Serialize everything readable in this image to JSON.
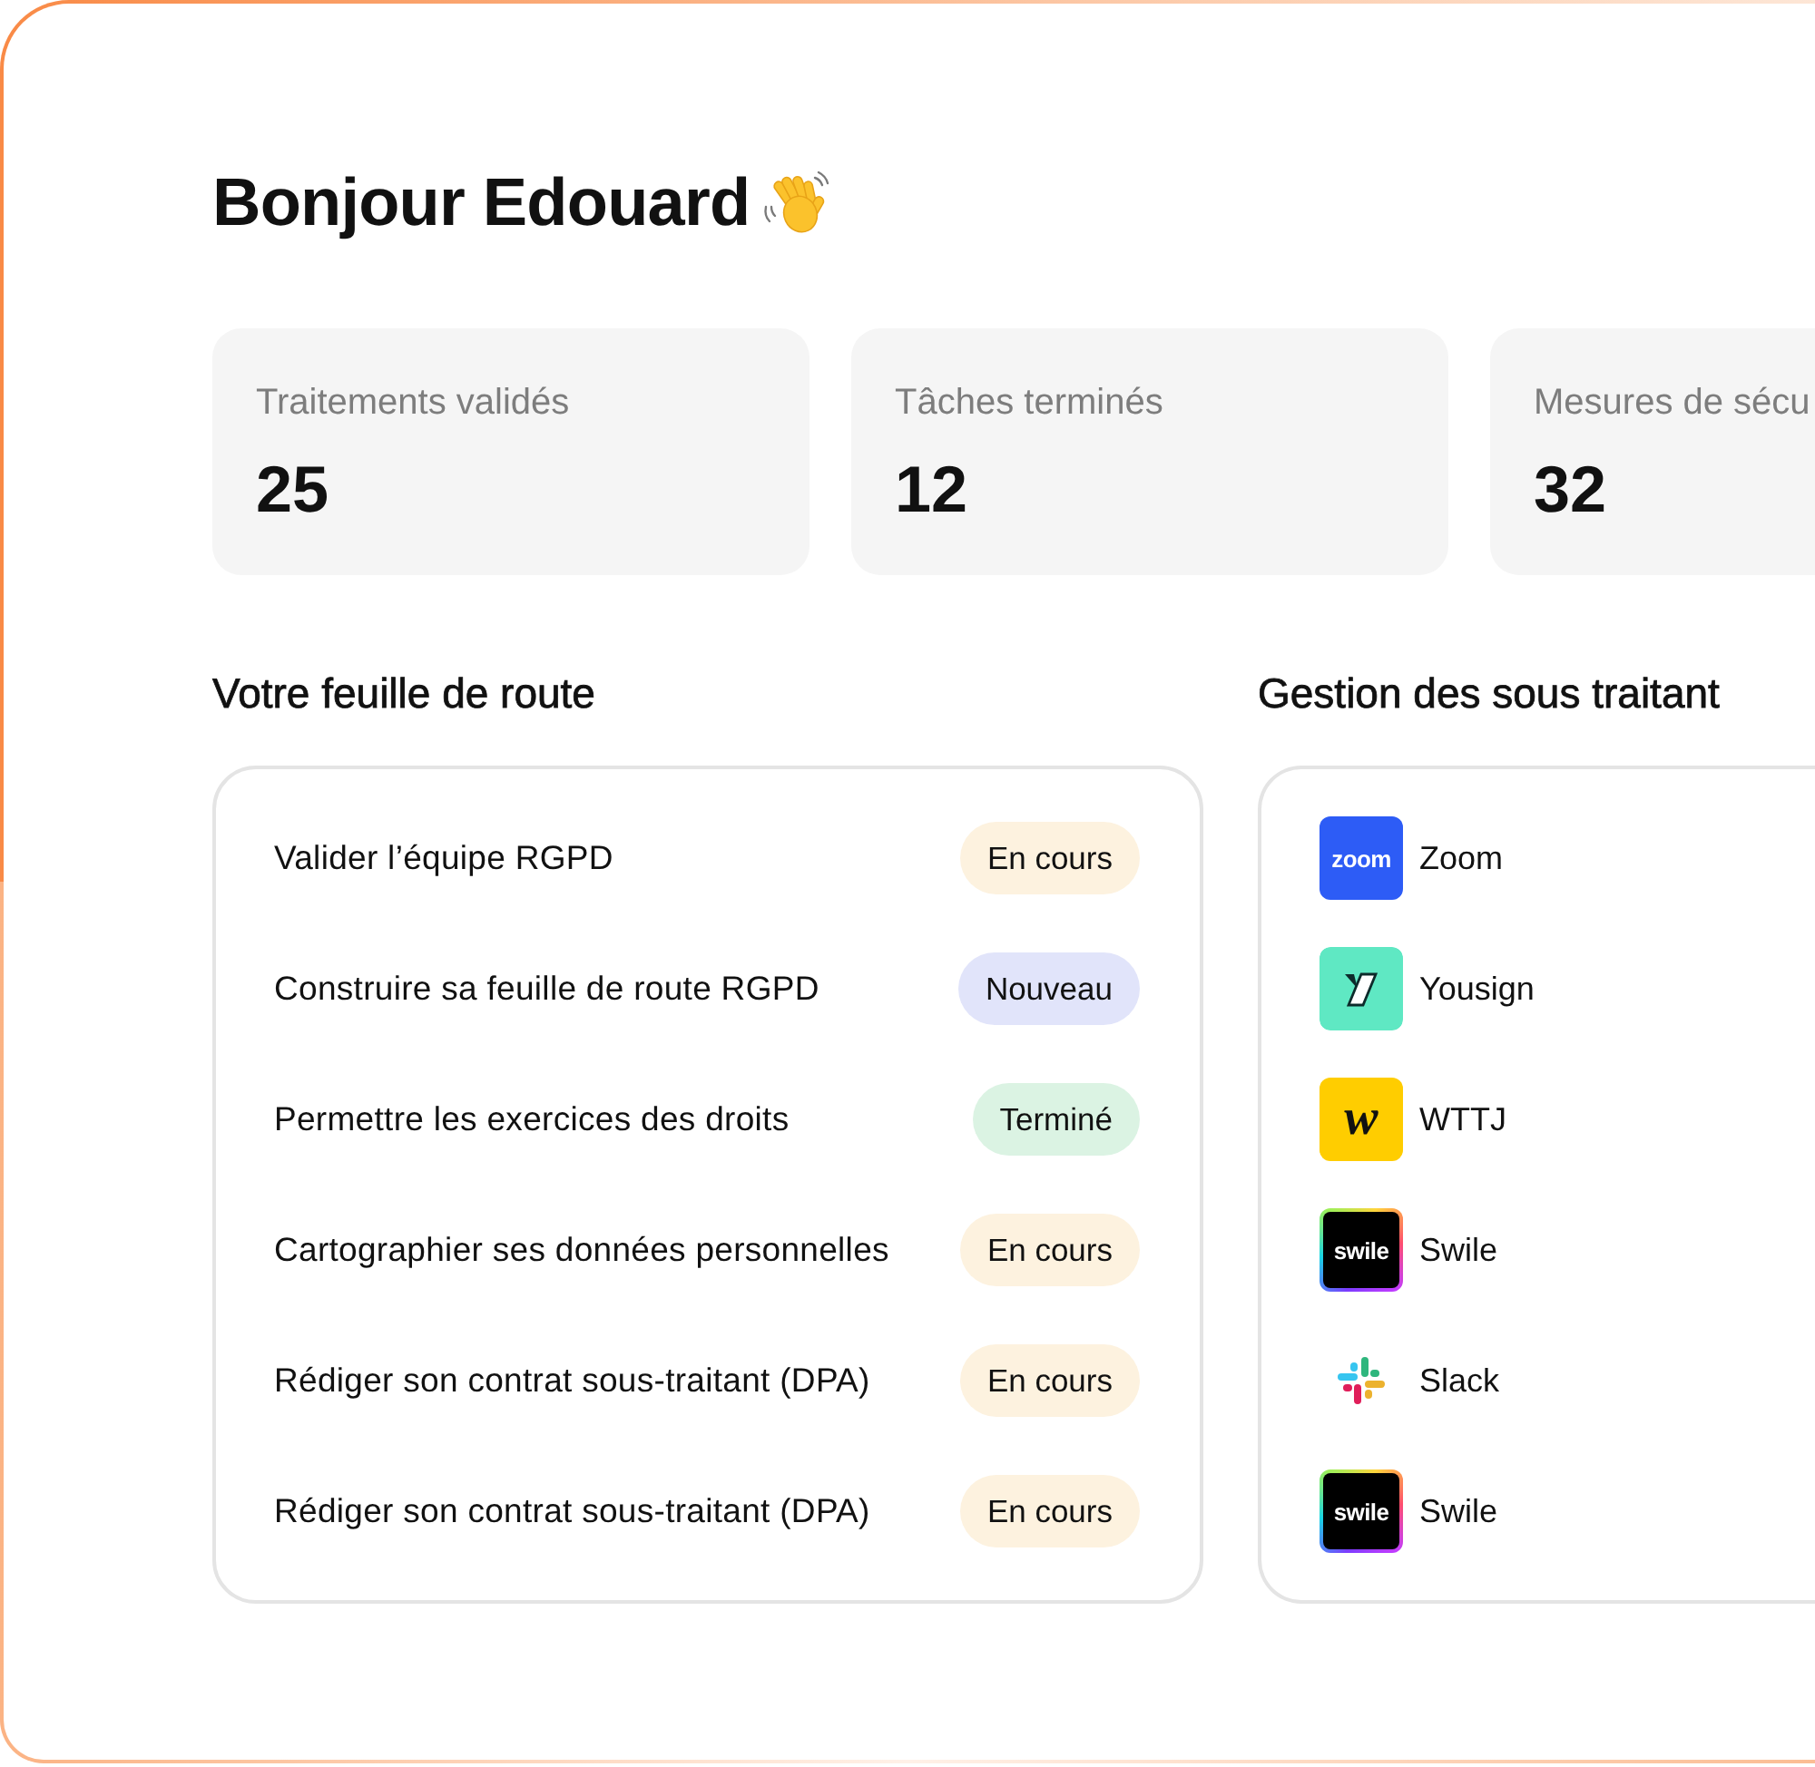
{
  "greeting": {
    "title": "Bonjour Edouard"
  },
  "stats": [
    {
      "label": "Traitements validés",
      "value": "25"
    },
    {
      "label": "Tâches terminés",
      "value": "12"
    },
    {
      "label": "Mesures de sécu",
      "value": "32"
    }
  ],
  "roadmap": {
    "title": "Votre feuille de route",
    "items": [
      {
        "label": "Valider l’équipe RGPD",
        "badge": "En cours",
        "color": "#fdf2df"
      },
      {
        "label": "Construire sa feuille de route RGPD",
        "badge": "Nouveau",
        "color": "#e1e4fa"
      },
      {
        "label": "Permettre les exercices des droits",
        "badge": "Terminé",
        "color": "#dbf3e3"
      },
      {
        "label": "Cartographier ses données personnelles",
        "badge": "En cours",
        "color": "#fdf2df"
      },
      {
        "label": "Rédiger son contrat sous-traitant (DPA)",
        "badge": "En cours",
        "color": "#fdf2df"
      },
      {
        "label": "Rédiger son contrat sous-traitant (DPA)",
        "badge": "En cours",
        "color": "#fdf2df"
      }
    ]
  },
  "subcontractors": {
    "title": "Gestion des sous traitant",
    "items": [
      {
        "name": "Zoom",
        "logo": {
          "kind": "wordmark",
          "text": "zoom",
          "color": "#2d5cf6",
          "ring": false
        }
      },
      {
        "name": "Yousign",
        "logo": {
          "kind": "slash",
          "color": "#5fe8c3"
        }
      },
      {
        "name": "WTTJ",
        "logo": {
          "kind": "letter",
          "text": "w",
          "color": "#ffcd00"
        }
      },
      {
        "name": "Swile",
        "logo": {
          "kind": "wordmark",
          "text": "swile",
          "color": "#000000",
          "ring": true
        }
      },
      {
        "name": "Slack",
        "logo": {
          "kind": "pinwheel"
        }
      },
      {
        "name": "Swile",
        "logo": {
          "kind": "wordmark",
          "text": "swile",
          "color": "#000000",
          "ring": true
        }
      }
    ]
  }
}
